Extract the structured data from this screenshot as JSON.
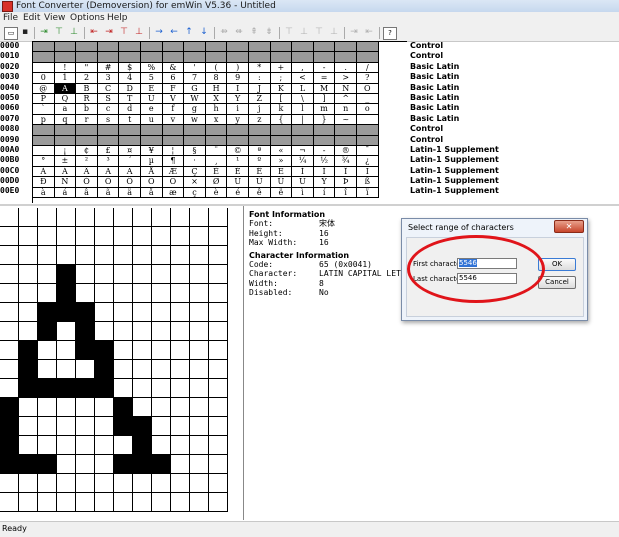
{
  "window": {
    "title": "Font Converter (Demoversion) for emWin V5.36 - Untitled"
  },
  "menu": [
    "File",
    "Edit",
    "View",
    "Options",
    "Help"
  ],
  "char_table": {
    "rows": [
      {
        "code": "0000",
        "range": "Control",
        "disabled": true,
        "chars": [
          "",
          "",
          "",
          "",
          "",
          "",
          "",
          "",
          "",
          "",
          "",
          "",
          "",
          "",
          "",
          ""
        ]
      },
      {
        "code": "0010",
        "range": "Control",
        "disabled": true,
        "chars": [
          "",
          "",
          "",
          "",
          "",
          "",
          "",
          "",
          "",
          "",
          "",
          "",
          "",
          "",
          "",
          ""
        ]
      },
      {
        "code": "0020",
        "range": "Basic Latin",
        "disabled": false,
        "chars": [
          "",
          " !",
          "\"",
          "#",
          "$",
          "%",
          "&",
          "'",
          "(",
          ")",
          "*",
          "+",
          ",",
          "-",
          ".",
          "/"
        ]
      },
      {
        "code": "0030",
        "range": "Basic Latin",
        "disabled": false,
        "chars": [
          "0",
          "1",
          "2",
          "3",
          "4",
          "5",
          "6",
          "7",
          "8",
          "9",
          ":",
          ";",
          "<",
          "=",
          ">",
          "?"
        ]
      },
      {
        "code": "0040",
        "range": "Basic Latin",
        "disabled": false,
        "chars": [
          "@",
          "A",
          "B",
          "C",
          "D",
          "E",
          "F",
          "G",
          "H",
          "I",
          "J",
          "K",
          "L",
          "M",
          "N",
          "O"
        ]
      },
      {
        "code": "0050",
        "range": "Basic Latin",
        "disabled": false,
        "chars": [
          "P",
          "Q",
          "R",
          "S",
          "T",
          "U",
          "V",
          "W",
          "X",
          "Y",
          "Z",
          "[",
          "\\",
          "]",
          "^",
          "_"
        ]
      },
      {
        "code": "0060",
        "range": "Basic Latin",
        "disabled": false,
        "chars": [
          "`",
          "a",
          "b",
          "c",
          "d",
          "e",
          "f",
          "g",
          "h",
          "i",
          "j",
          "k",
          "l",
          "m",
          "n",
          "o"
        ]
      },
      {
        "code": "0070",
        "range": "Basic Latin",
        "disabled": false,
        "chars": [
          "p",
          "q",
          "r",
          "s",
          "t",
          "u",
          "v",
          "w",
          "x",
          "y",
          "z",
          "{",
          "|",
          "}",
          "~",
          ""
        ]
      },
      {
        "code": "0080",
        "range": "Control",
        "disabled": true,
        "chars": [
          "",
          "",
          "",
          "",
          "",
          "",
          "",
          "",
          "",
          "",
          "",
          "",
          "",
          "",
          "",
          ""
        ]
      },
      {
        "code": "0090",
        "range": "Control",
        "disabled": true,
        "chars": [
          "",
          "",
          "",
          "",
          "",
          "",
          "",
          "",
          "",
          "",
          "",
          "",
          "",
          "",
          "",
          ""
        ]
      },
      {
        "code": "00A0",
        "range": "Latin-1 Supplement",
        "disabled": false,
        "chars": [
          "",
          "¡",
          "¢",
          "£",
          "¤",
          "¥",
          "¦",
          "§",
          "¨",
          "©",
          "ª",
          "«",
          "¬",
          "-",
          "®",
          "¯"
        ]
      },
      {
        "code": "00B0",
        "range": "Latin-1 Supplement",
        "disabled": false,
        "chars": [
          "°",
          "±",
          "²",
          "³",
          "´",
          "µ",
          "¶",
          "·",
          "¸",
          "¹",
          "º",
          "»",
          "¼",
          "½",
          "¾",
          "¿"
        ]
      },
      {
        "code": "00C0",
        "range": "Latin-1 Supplement",
        "disabled": false,
        "chars": [
          "À",
          "Á",
          "Â",
          "Ã",
          "Ä",
          "Å",
          "Æ",
          "Ç",
          "È",
          "É",
          "Ê",
          "Ë",
          "Ì",
          "Í",
          "Î",
          "Ï"
        ]
      },
      {
        "code": "00D0",
        "range": "Latin-1 Supplement",
        "disabled": false,
        "chars": [
          "Ð",
          "Ñ",
          "Ò",
          "Ó",
          "Ô",
          "Õ",
          "Ö",
          "×",
          "Ø",
          "Ù",
          "Ú",
          "Û",
          "Ü",
          "Ý",
          "Þ",
          "ß"
        ]
      },
      {
        "code": "00E0",
        "range": "Latin-1 Supplement",
        "disabled": false,
        "chars": [
          "à",
          "á",
          "â",
          "ã",
          "ä",
          "å",
          "æ",
          "ç",
          "è",
          "é",
          "ê",
          "ë",
          "ì",
          "í",
          "î",
          "ï"
        ]
      }
    ],
    "selected_code": "0041"
  },
  "glyph_bitmap": [
    "000000000000",
    "000000000000",
    "000000000000",
    "000100000000",
    "000100000000",
    "001110000000",
    "001010000000",
    "010011000000",
    "010001000000",
    "011111000000",
    "100000100000",
    "100000110000",
    "100000010000",
    "111000111000",
    "000000000000",
    "000000000000"
  ],
  "font_info": {
    "heading": "Font Information",
    "items": [
      {
        "k": "Font:",
        "v": "宋体"
      },
      {
        "k": "Height:",
        "v": "16"
      },
      {
        "k": "Max Width:",
        "v": "16"
      }
    ]
  },
  "char_info": {
    "heading": "Character Information",
    "items": [
      {
        "k": "Code:",
        "v": "65 (0x0041)"
      },
      {
        "k": "Character:",
        "v": "LATIN CAPITAL LET"
      },
      {
        "k": "Width:",
        "v": "8"
      },
      {
        "k": "Disabled:",
        "v": "No"
      }
    ]
  },
  "dialog": {
    "title": "Select range of characters",
    "first_label": "First character",
    "first_value": "5546",
    "last_label": "Last character",
    "last_value": "5546",
    "ok_label": "OK",
    "cancel_label": "Cancel",
    "close_symbol": "✕"
  },
  "status": {
    "text": "Ready"
  },
  "colors": {
    "highlight_oval": "#e0141a",
    "disabled_cell": "#9a9a9a",
    "selection": "#3173d6"
  }
}
